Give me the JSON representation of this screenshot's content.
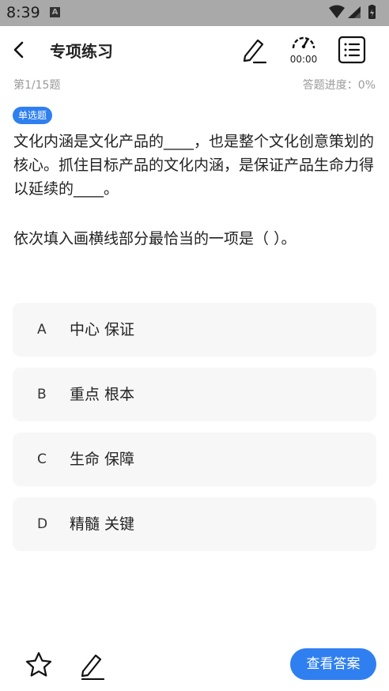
{
  "status_bar": {
    "time": "8:39",
    "notification_icon": "A"
  },
  "header": {
    "title": "专项练习",
    "timer": "00:00"
  },
  "question": {
    "index": "第1/15题",
    "progress": "答题进度：0%",
    "type_badge": "单选题",
    "stem": "文化内涵是文化产品的____，也是整个文化创意策划的核心。抓住目标产品的文化内涵，是保证产品生命力得以延续的____。",
    "prompt": "依次填入画横线部分最恰当的一项是（  ）。"
  },
  "options": [
    {
      "letter": "A",
      "text": "中心 保证"
    },
    {
      "letter": "B",
      "text": "重点 根本"
    },
    {
      "letter": "C",
      "text": "生命 保障"
    },
    {
      "letter": "D",
      "text": "精髓 关键"
    }
  ],
  "bottom_bar": {
    "answer_button": "查看答案"
  },
  "colors": {
    "accent": "#2f7ff0",
    "status_bar": "#a9a9a9",
    "option_bg": "#f7f7f7",
    "muted_text": "#9a9a9a"
  },
  "icons": [
    "back-icon",
    "pen-icon",
    "speedometer-icon",
    "list-icon",
    "star-icon",
    "edit-icon",
    "wifi-icon",
    "signal-icon",
    "battery-icon"
  ]
}
